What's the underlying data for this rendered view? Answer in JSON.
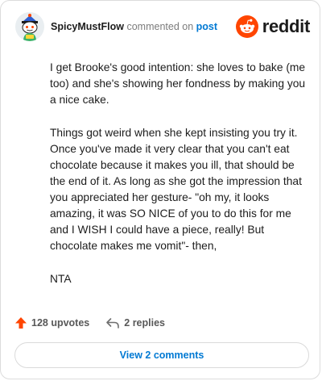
{
  "header": {
    "author": "SpicyMustFlow",
    "action_text": "commented on",
    "post_link": "post",
    "logo_text": "reddit"
  },
  "comment": {
    "paragraphs": [
      "I get Brooke's good intention: she loves to bake (me too) and she's showing her fondness by making you a nice cake.",
      "Things got weird when she kept insisting you try it. Once you've made it very clear that you can't eat chocolate because it makes you ill, that should be the end of it. As long as she got the impression that you appreciated her gesture- \"oh my, it looks amazing, it was SO NICE of you to do this for me and I WISH I could have a piece, really! But chocolate makes me vomit\"- then,",
      "NTA"
    ]
  },
  "stats": {
    "upvotes": "128 upvotes",
    "replies": "2 replies"
  },
  "footer": {
    "view_comments": "View 2 comments"
  },
  "colors": {
    "reddit_orange": "#ff4500",
    "link_blue": "#0079d3",
    "muted_text": "#7c7c7c"
  },
  "icons": {
    "upvote": "upvote-arrow-icon",
    "reply": "reply-arrow-icon",
    "logo": "reddit-snoo-icon",
    "avatar": "snoo-avatar-icon"
  }
}
